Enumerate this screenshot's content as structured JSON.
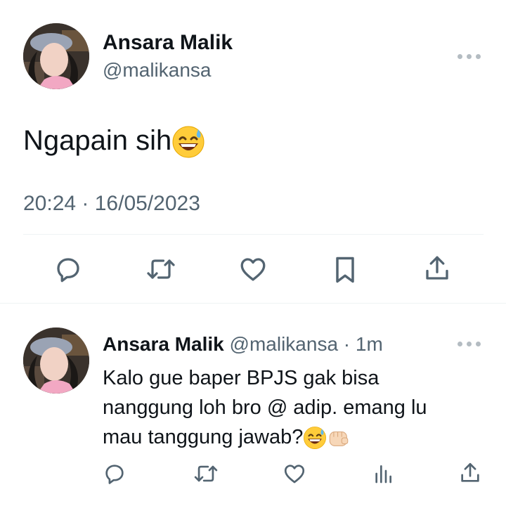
{
  "main_tweet": {
    "author_name": "Ansara Malik",
    "author_handle": "@malikansa",
    "text": "Ngapain sih",
    "timestamp": "20:24 · 16/05/2023"
  },
  "reply_tweet": {
    "author_name": "Ansara Malik",
    "author_handle": "@malikansa",
    "time_ago": "· 1m",
    "text_line1": "Kalo gue baper BPJS gak bisa",
    "text_line2": "nanggung loh bro @ adip. emang lu",
    "text_line3": "mau tanggung jawab?"
  },
  "icons": {
    "reply": "reply-icon",
    "retweet": "retweet-icon",
    "like": "heart-icon",
    "bookmark": "bookmark-icon",
    "share": "share-icon",
    "views": "views-icon",
    "more": "more-icon",
    "emoji_sweat_smile": "grinning-sweat-emoji",
    "emoji_fist": "fist-bump-emoji"
  },
  "colors": {
    "text": "#0f1419",
    "muted": "#536471",
    "divider": "#eff3f4"
  }
}
